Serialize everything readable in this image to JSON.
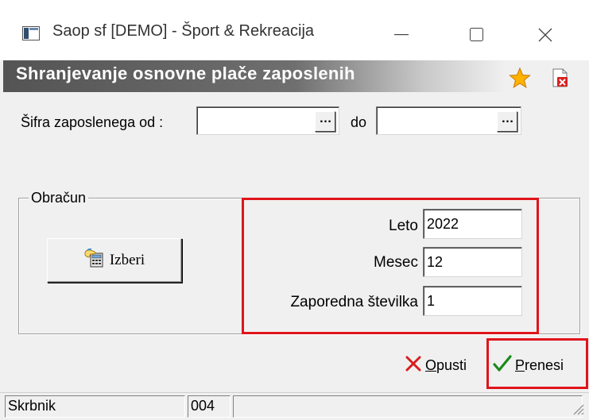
{
  "window": {
    "title": "Saop sf [DEMO] - Šport & Rekreacija",
    "controls": {
      "minimize": "—",
      "maximize": "☐",
      "close": "✕"
    }
  },
  "banner": {
    "title": "Shranjevanje osnovne plače zaposlenih",
    "icons": [
      "star-icon",
      "document-delete-icon"
    ]
  },
  "range": {
    "from_label": "Šifra zaposlenega od :",
    "from_value": "",
    "to_label": "do",
    "to_value": "",
    "browse_label": "…"
  },
  "obracun": {
    "group_title": "Obračun",
    "select_button": "Izberi",
    "leto_label": "Leto",
    "leto_value": "2022",
    "mesec_label": "Mesec",
    "mesec_value": "12",
    "zaporedna_label": "Zaporedna številka",
    "zaporedna_value": "1"
  },
  "actions": {
    "cancel_label": "Opusti",
    "confirm_label": "Prenesi"
  },
  "statusbar": {
    "user": "Skrbnik",
    "code": "004",
    "info": ""
  },
  "colors": {
    "highlight": "#e0141b",
    "banner_dark": "#545454",
    "cancel_x": "#d91d1d",
    "confirm_check": "#1a8a1a"
  }
}
